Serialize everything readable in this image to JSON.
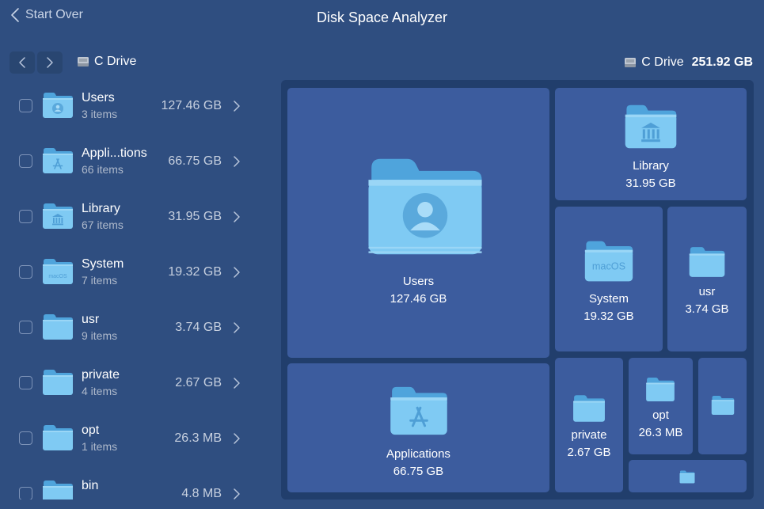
{
  "header": {
    "back_label": "Start Over",
    "title": "Disk Space Analyzer"
  },
  "nav": {
    "drive_name": "C Drive"
  },
  "summary": {
    "drive_name": "C Drive",
    "total_size": "251.92 GB"
  },
  "folder_list": [
    {
      "name": "Users",
      "count": "3 items",
      "size": "127.46 GB",
      "icon": "person-folder-icon"
    },
    {
      "name": "Appli...tions",
      "count": "66 items",
      "size": "66.75 GB",
      "icon": "appstore-folder-icon"
    },
    {
      "name": "Library",
      "count": "67 items",
      "size": "31.95 GB",
      "icon": "library-folder-icon"
    },
    {
      "name": "System",
      "count": "7 items",
      "size": "19.32 GB",
      "icon": "macos-folder-icon"
    },
    {
      "name": "usr",
      "count": "9 items",
      "size": "3.74 GB",
      "icon": "folder-icon"
    },
    {
      "name": "private",
      "count": "4 items",
      "size": "2.67 GB",
      "icon": "folder-icon"
    },
    {
      "name": "opt",
      "count": "1 items",
      "size": "26.3 MB",
      "icon": "folder-icon"
    },
    {
      "name": "bin",
      "count": "",
      "size": "4.8 MB",
      "icon": "folder-icon"
    }
  ],
  "system_badge": "macOS",
  "treemap": {
    "tiles": [
      {
        "name": "Users",
        "size": "127.46 GB"
      },
      {
        "name": "Applications",
        "size": "66.75 GB"
      },
      {
        "name": "Library",
        "size": "31.95 GB"
      },
      {
        "name": "System",
        "size": "19.32 GB"
      },
      {
        "name": "usr",
        "size": "3.74 GB"
      },
      {
        "name": "private",
        "size": "2.67 GB"
      },
      {
        "name": "opt",
        "size": "26.3 MB"
      }
    ]
  },
  "colors": {
    "background": "#2f4e80",
    "treemap_bg": "#213e6c",
    "tile": "#3c5c9e",
    "folder_light": "#79c7f2",
    "folder_dark": "#4fa4dc"
  }
}
